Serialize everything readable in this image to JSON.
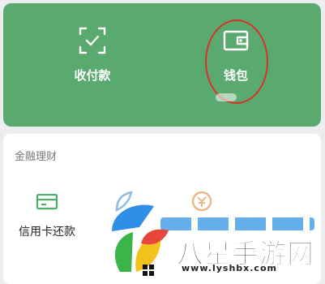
{
  "top_actions": {
    "pay_label": "收付款",
    "wallet_label": "钱包"
  },
  "finance": {
    "title": "金融理财",
    "credit_card_label": "信用卡还款"
  },
  "watermark": {
    "title": "八星手游网",
    "url": "www.lyshbx.com"
  },
  "colors": {
    "green_card": "#5aa96e",
    "annotation_circle": "#d7312c",
    "credit_icon": "#4caf6a"
  }
}
